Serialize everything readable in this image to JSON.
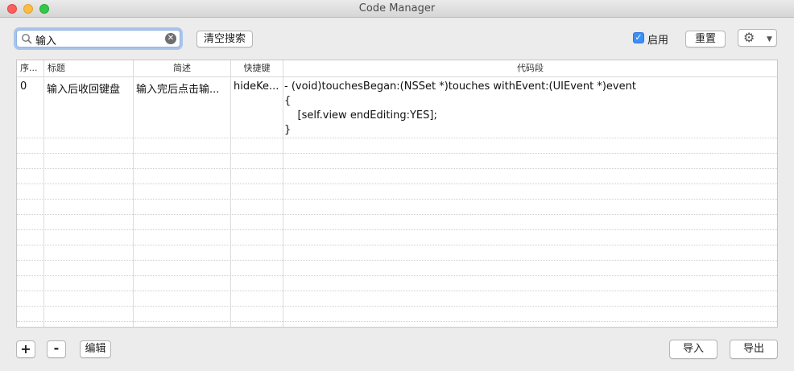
{
  "window": {
    "title": "Code Manager"
  },
  "toolbar": {
    "search_value": "输入",
    "clear_search_label": "清空搜索",
    "enable_label": "启用",
    "enable_checked": true,
    "reset_label": "重置",
    "settings_icon": "gear-icon"
  },
  "table": {
    "headers": [
      "序...",
      "标题",
      "简述",
      "快捷键",
      "代码段"
    ],
    "rows": [
      {
        "index": "0",
        "title": "输入后收回键盘",
        "summary": "输入完后点击输...",
        "shortcut": "hideKe...",
        "code": [
          "- (void)touchesBegan:(NSSet *)touches withEvent:(UIEvent *)event",
          "{",
          "    [self.view endEditing:YES];",
          "}"
        ]
      }
    ]
  },
  "footer": {
    "add_label": "+",
    "remove_label": "-",
    "edit_label": "编辑",
    "import_label": "导入",
    "export_label": "导出"
  },
  "colors": {
    "accent": "#3b8ff5",
    "focus_ring": "#5a96e6"
  }
}
